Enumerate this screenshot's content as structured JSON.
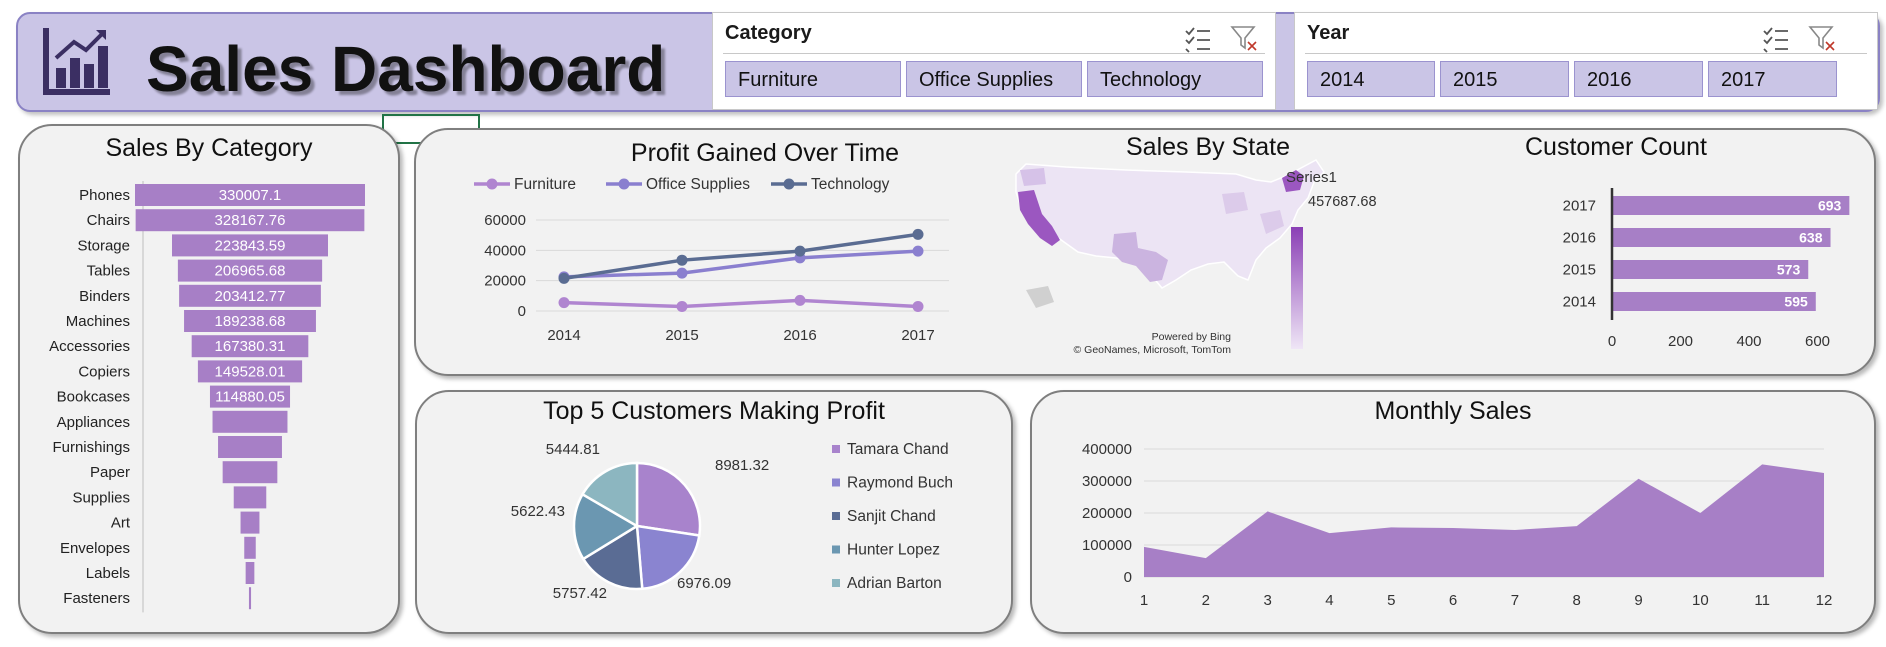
{
  "header": {
    "title": "Sales Dashboard"
  },
  "slicers": {
    "category": {
      "title": "Category",
      "items": [
        "Furniture",
        "Office Supplies",
        "Technology"
      ]
    },
    "year": {
      "title": "Year",
      "items": [
        "2014",
        "2015",
        "2016",
        "2017"
      ]
    }
  },
  "colors": {
    "accent": "#a77fc6",
    "header_bg": "#cac5e6",
    "furniture": "#b085d0",
    "office": "#8a7fcf",
    "technology": "#5a6c92"
  },
  "chart_data": [
    {
      "id": "sales_by_category",
      "type": "bar",
      "title": "Sales By Category",
      "orientation": "horizontal-funnel",
      "categories": [
        "Phones",
        "Chairs",
        "Storage",
        "Tables",
        "Binders",
        "Machines",
        "Accessories",
        "Copiers",
        "Bookcases",
        "Appliances",
        "Furnishings",
        "Paper",
        "Supplies",
        "Art",
        "Envelopes",
        "Labels",
        "Fasteners"
      ],
      "values": [
        330007.1,
        328167.76,
        223843.59,
        206965.68,
        203412.77,
        189238.68,
        167380.31,
        149528.01,
        114880.05,
        107532.16,
        91705.16,
        78479.21,
        46673.54,
        27118.79,
        16476.4,
        12486.31,
        3024.28
      ],
      "data_labels": [
        "330007.1",
        "328167.76",
        "223843.59",
        "206965.68",
        "203412.77",
        "189238.68",
        "167380.31",
        "149528.01",
        "114880.05",
        "",
        "",
        "",
        "",
        "",
        "",
        "",
        ""
      ]
    },
    {
      "id": "profit_over_time",
      "type": "line",
      "title": "Profit Gained Over Time",
      "x": [
        "2014",
        "2015",
        "2016",
        "2017"
      ],
      "series": [
        {
          "name": "Furniture",
          "values": [
            5500,
            3000,
            7000,
            3000
          ]
        },
        {
          "name": "Office Supplies",
          "values": [
            22500,
            25000,
            35000,
            39500
          ]
        },
        {
          "name": "Technology",
          "values": [
            21500,
            33500,
            39500,
            50500
          ]
        }
      ],
      "ylim": [
        0,
        60000
      ],
      "yticks": [
        "0",
        "20000",
        "40000",
        "60000"
      ],
      "legend": "top",
      "grid": true
    },
    {
      "id": "sales_by_state",
      "type": "map",
      "title": "Sales By State",
      "legend": {
        "series": "Series1",
        "max_label": "457687.68"
      },
      "attribution": [
        "Powered by Bing",
        "© GeoNames, Microsoft, TomTom"
      ]
    },
    {
      "id": "customer_count",
      "type": "bar",
      "title": "Customer Count",
      "orientation": "horizontal",
      "categories": [
        "2017",
        "2016",
        "2015",
        "2014"
      ],
      "values": [
        693,
        638,
        573,
        595
      ],
      "xlim": [
        0,
        800
      ],
      "xticks": [
        "0",
        "200",
        "400",
        "600",
        "800"
      ]
    },
    {
      "id": "top5_customers",
      "type": "pie",
      "title": "Top 5 Customers Making Profit",
      "labels": [
        "Tamara Chand",
        "Raymond Buch",
        "Sanjit Chand",
        "Hunter Lopez",
        "Adrian Barton"
      ],
      "values": [
        8981.32,
        6976.09,
        5757.42,
        5622.43,
        5444.81
      ],
      "data_labels": [
        "8981.32",
        "6976.09",
        "5757.42",
        "5622.43",
        "5444.81"
      ],
      "colors": [
        "#a883cc",
        "#8a84d0",
        "#5a6c94",
        "#6b97b1",
        "#8cb6c0"
      ],
      "legend": "right"
    },
    {
      "id": "monthly_sales",
      "type": "area",
      "title": "Monthly Sales",
      "x": [
        "1",
        "2",
        "3",
        "4",
        "5",
        "6",
        "7",
        "8",
        "9",
        "10",
        "11",
        "12"
      ],
      "values": [
        94000,
        59000,
        205000,
        137000,
        155000,
        153000,
        147000,
        159000,
        307000,
        200000,
        352000,
        325000
      ],
      "ylim": [
        0,
        400000
      ],
      "yticks": [
        "0",
        "100000",
        "200000",
        "300000",
        "400000"
      ]
    }
  ]
}
